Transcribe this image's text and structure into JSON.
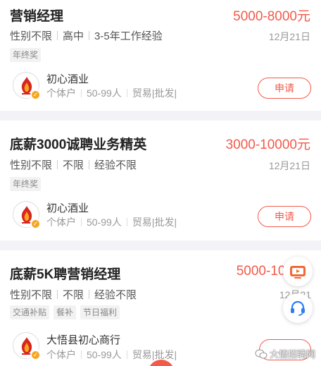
{
  "jobs": [
    {
      "title": "营销经理",
      "salary": "5000-8000元",
      "reqs": [
        "性别不限",
        "高中",
        "3-5年工作经验"
      ],
      "date": "12月21日",
      "tags": [
        "年终奖"
      ],
      "company": "初心酒业",
      "company_info": [
        "个体户",
        "50-99人",
        "贸易|批发|"
      ],
      "apply_label": "申请"
    },
    {
      "title": "底薪3000诚聘业务精英",
      "salary": "3000-10000元",
      "reqs": [
        "性别不限",
        "不限",
        "经验不限"
      ],
      "date": "12月21日",
      "tags": [
        "年终奖"
      ],
      "company": "初心酒业",
      "company_info": [
        "个体户",
        "50-99人",
        "贸易|批发|"
      ],
      "apply_label": "申请"
    },
    {
      "title": "底薪5K聘营销经理",
      "salary": "5000-100",
      "reqs": [
        "性别不限",
        "不限",
        "经验不限"
      ],
      "date": "12月21",
      "tags": [
        "交通补贴",
        "餐补",
        "节日福利"
      ],
      "company": "大悟县初心商行",
      "company_info": [
        "个体户",
        "50-99人",
        "贸易|批发|"
      ],
      "apply_label": ""
    }
  ],
  "watermark": "大悟招聘网",
  "colors": {
    "accent": "#f25a4a",
    "badge": "#f5a623",
    "icon_orange": "#f06a35",
    "icon_blue": "#2d7df6"
  },
  "icons": [
    "tv-icon",
    "headset-icon",
    "verified-badge-icon",
    "wechat-icon"
  ]
}
